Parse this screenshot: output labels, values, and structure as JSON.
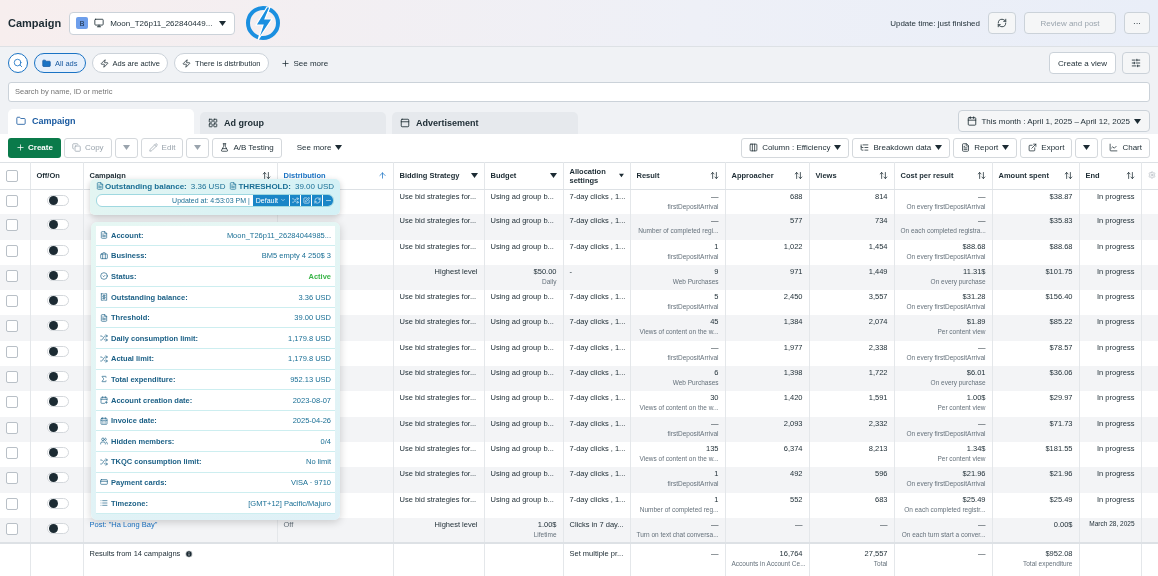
{
  "header": {
    "title": "Campaign",
    "account": {
      "badge": "B",
      "name": "Moon_T26p11_262840449..."
    },
    "update_text": "Update time: just finished",
    "review_button": {
      "label": "Review and post",
      "disabled": true
    },
    "more_button": "···"
  },
  "filters": {
    "chips": [
      {
        "label": "All ads",
        "selected": true
      },
      {
        "label": "Ads are active",
        "selected": false
      },
      {
        "label": "There is distribution",
        "selected": false
      }
    ],
    "see_more": "See more",
    "create_view": "Create a view"
  },
  "search": {
    "placeholder": "Search by name, ID or metric"
  },
  "tabs": [
    {
      "label": "Campaign",
      "selected": true
    },
    {
      "label": "Ad group",
      "selected": false
    },
    {
      "label": "Advertisement",
      "selected": false
    }
  ],
  "date_range": "This month : April 1, 2025 – April 12, 2025",
  "toolbar": {
    "left": [
      {
        "kind": "primary",
        "label": "Create",
        "disabled": false
      },
      {
        "kind": "button",
        "label": "Copy",
        "disabled": true
      },
      {
        "kind": "caret",
        "disabled": true
      },
      {
        "kind": "button",
        "label": "Edit",
        "disabled": true
      },
      {
        "kind": "caret",
        "disabled": true
      },
      {
        "kind": "button",
        "label": "A/B Testing",
        "disabled": false
      },
      {
        "kind": "menu",
        "label": "See more",
        "disabled": false
      }
    ],
    "right": [
      {
        "kind": "columns",
        "label": "Column : Efficiency"
      },
      {
        "kind": "breakdown",
        "label": "Breakdown data"
      },
      {
        "kind": "report",
        "label": "Report"
      },
      {
        "kind": "export",
        "label": "Export"
      },
      {
        "kind": "caret"
      },
      {
        "kind": "chart",
        "label": "Chart"
      }
    ]
  },
  "table": {
    "select_all": false,
    "columns": [
      {
        "label": "Off/On",
        "sortable": false,
        "sorted": false,
        "menu": false
      },
      {
        "label": "Campaign",
        "sortable": true,
        "sorted": false,
        "menu": false
      },
      {
        "label": "Distribution",
        "sortable": true,
        "sorted": true,
        "menu": false
      },
      {
        "label": "Bidding Strategy",
        "sortable": false,
        "sorted": false,
        "menu": true
      },
      {
        "label": "Budget",
        "sortable": false,
        "sorted": false,
        "menu": true
      },
      {
        "label": "Allocation settings",
        "sortable": false,
        "sorted": false,
        "menu": true
      },
      {
        "label": "Result",
        "sortable": true,
        "sorted": false,
        "menu": false
      },
      {
        "label": "Approacher",
        "sortable": true,
        "sorted": false,
        "menu": false
      },
      {
        "label": "Views",
        "sortable": true,
        "sorted": false,
        "menu": false
      },
      {
        "label": "Cost per result",
        "sortable": true,
        "sorted": false,
        "menu": false
      },
      {
        "label": "Amount spent",
        "sortable": true,
        "sorted": false,
        "menu": false
      },
      {
        "label": "End",
        "sortable": true,
        "sorted": false,
        "menu": false
      }
    ],
    "rows": [
      {
        "checked": false,
        "on": false,
        "bidding": "Use bid strategies for...",
        "budget": "Using ad group b...",
        "allocation": "7-day clicks , 1...",
        "result": "—",
        "result_note": "firstDepositArrival",
        "approacher": "688",
        "views": "814",
        "cost": "—",
        "cost_note": "On every firstDepositArrival",
        "spent": "$38.87",
        "end": "In progress"
      },
      {
        "checked": false,
        "on": false,
        "bidding": "Use bid strategies for...",
        "budget": "Using ad group b...",
        "allocation": "7-day clicks , 1...",
        "result": "—",
        "result_note": "Number of completed regi...",
        "approacher": "577",
        "views": "734",
        "cost": "—",
        "cost_note": "On each completed registra...",
        "spent": "$35.83",
        "end": "In progress"
      },
      {
        "checked": false,
        "on": false,
        "bidding": "Use bid strategies for...",
        "budget": "Using ad group b...",
        "allocation": "7-day clicks , 1...",
        "result": "1",
        "result_note": "firstDepositArrival",
        "approacher": "1,022",
        "views": "1,454",
        "cost": "$88.68",
        "cost_note": "On every firstDepositArrival",
        "spent": "$88.68",
        "end": "In progress"
      },
      {
        "checked": false,
        "on": false,
        "bidding": "Highest level",
        "budget": "$50.00",
        "budget_note": "Daily",
        "allocation": "-",
        "result": "9",
        "result_note": "Web Purchases",
        "approacher": "971",
        "views": "1,449",
        "cost": "11.31$",
        "cost_note": "On every purchase",
        "spent": "$101.75",
        "end": "In progress"
      },
      {
        "checked": false,
        "on": false,
        "bidding": "Use bid strategies for...",
        "budget": "Using ad group b...",
        "allocation": "7-day clicks , 1...",
        "result": "5",
        "result_note": "firstDepositArrival",
        "approacher": "2,450",
        "views": "3,557",
        "cost": "$31.28",
        "cost_note": "On every firstDepositArrival",
        "spent": "$156.40",
        "end": "In progress"
      },
      {
        "checked": false,
        "on": false,
        "bidding": "Use bid strategies for...",
        "budget": "Using ad group b...",
        "allocation": "7-day clicks , 1...",
        "result": "45",
        "result_note": "Views of content on the w...",
        "approacher": "1,384",
        "views": "2,074",
        "cost": "$1.89",
        "cost_note": "Per content view",
        "spent": "$85.22",
        "end": "In progress"
      },
      {
        "checked": false,
        "on": false,
        "bidding": "Use bid strategies for...",
        "budget": "Using ad group b...",
        "allocation": "7-day clicks , 1...",
        "result": "—",
        "result_note": "firstDepositArrival",
        "approacher": "1,977",
        "views": "2,338",
        "cost": "—",
        "cost_note": "On every firstDepositArrival",
        "spent": "$78.57",
        "end": "In progress"
      },
      {
        "checked": false,
        "on": false,
        "bidding": "Use bid strategies for...",
        "budget": "Using ad group b...",
        "allocation": "7-day clicks , 1...",
        "result": "6",
        "result_note": "Web Purchases",
        "approacher": "1,398",
        "views": "1,722",
        "cost": "$6.01",
        "cost_note": "On every purchase",
        "spent": "$36.06",
        "end": "In progress"
      },
      {
        "checked": false,
        "on": false,
        "bidding": "Use bid strategies for...",
        "budget": "Using ad group b...",
        "allocation": "7-day clicks , 1...",
        "result": "30",
        "result_note": "Views of content on the w...",
        "approacher": "1,420",
        "views": "1,591",
        "cost": "1.00$",
        "cost_note": "Per content view",
        "spent": "$29.97",
        "end": "In progress"
      },
      {
        "checked": false,
        "on": false,
        "bidding": "Use bid strategies for...",
        "budget": "Using ad group b...",
        "allocation": "7-day clicks , 1...",
        "result": "—",
        "result_note": "firstDepositArrival",
        "approacher": "2,093",
        "views": "2,332",
        "cost": "—",
        "cost_note": "On every firstDepositArrival",
        "spent": "$71.73",
        "end": "In progress"
      },
      {
        "checked": false,
        "on": false,
        "bidding": "Use bid strategies for...",
        "budget": "Using ad group b...",
        "allocation": "7-day clicks , 1...",
        "result": "135",
        "result_note": "Views of content on the w...",
        "approacher": "6,374",
        "views": "8,213",
        "cost": "1.34$",
        "cost_note": "Per content view",
        "spent": "$181.55",
        "end": "In progress"
      },
      {
        "checked": false,
        "on": false,
        "bidding": "Use bid strategies for...",
        "budget": "Using ad group b...",
        "allocation": "7-day clicks , 1...",
        "result": "1",
        "result_note": "firstDepositArrival",
        "approacher": "492",
        "views": "596",
        "cost": "$21.96",
        "cost_note": "On every firstDepositArrival",
        "spent": "$21.96",
        "end": "In progress"
      },
      {
        "checked": false,
        "on": false,
        "bidding": "Use bid strategies for...",
        "budget": "Using ad group b...",
        "allocation": "7-day clicks , 1...",
        "result": "1",
        "result_note": "Number of completed reg...",
        "approacher": "552",
        "views": "683",
        "cost": "$25.49",
        "cost_note": "On each completed registr...",
        "spent": "$25.49",
        "end": "In progress"
      },
      {
        "checked": false,
        "on": false,
        "campaign": "Post: \"Ha Long Bay\"",
        "distribution": "Off",
        "bidding": "Highest level",
        "budget": "1.00$",
        "budget_note": "Lifetime",
        "allocation": "Clicks in 7 day...",
        "result": "—",
        "result_note": "Turn on text chat conversa...",
        "approacher": "—",
        "views": "—",
        "cost": "—",
        "cost_note": "On each turn start a conver...",
        "spent": "0.00$",
        "end": "March 28, 2025"
      }
    ],
    "footer": {
      "summary": "Results from 14 campaigns",
      "allocation": "Set multiple pr...",
      "result": "—",
      "approacher": "16,764",
      "approacher_note": "Accounts in Account Ce...",
      "views": "27,557",
      "views_note": "Total",
      "cost": "—",
      "spent": "$952.08",
      "spent_note": "Total expenditure"
    }
  },
  "balance_bar": {
    "items": [
      {
        "label": "Outstanding balance:",
        "value": "3.36 USD"
      },
      {
        "label": "THRESHOLD:",
        "value": "39.00 USD"
      }
    ],
    "updated": "Updated at: 4:53:03 PM |",
    "preset": "Default"
  },
  "account_card": [
    {
      "label": "Account:",
      "value": "Moon_T26p11_26284044985...",
      "highlight": false
    },
    {
      "label": "Business:",
      "value": "BM5 empty 4 250$ 3",
      "highlight": false
    },
    {
      "label": "Status:",
      "value": "Active",
      "highlight": true
    },
    {
      "label": "Outstanding balance:",
      "value": "3.36 USD",
      "highlight": false
    },
    {
      "label": "Threshold:",
      "value": "39.00 USD",
      "highlight": false
    },
    {
      "label": "Daily consumption limit:",
      "value": "1,179.8 USD",
      "highlight": false
    },
    {
      "label": "Actual limit:",
      "value": "1,179.8 USD",
      "highlight": false
    },
    {
      "label": "Total expenditure:",
      "value": "952.13 USD",
      "highlight": false
    },
    {
      "label": "Account creation date:",
      "value": "2023-08-07",
      "highlight": false
    },
    {
      "label": "Invoice date:",
      "value": "2025-04-26",
      "highlight": false
    },
    {
      "label": "Hidden members:",
      "value": "0/4",
      "highlight": false
    },
    {
      "label": "TKQC consumption limit:",
      "value": "No limit",
      "highlight": false
    },
    {
      "label": "Payment cards:",
      "value": "VISA · 9710",
      "highlight": false
    },
    {
      "label": "Timezone:",
      "value": "[GMT+12] Pacific/Majuro",
      "highlight": false
    }
  ]
}
